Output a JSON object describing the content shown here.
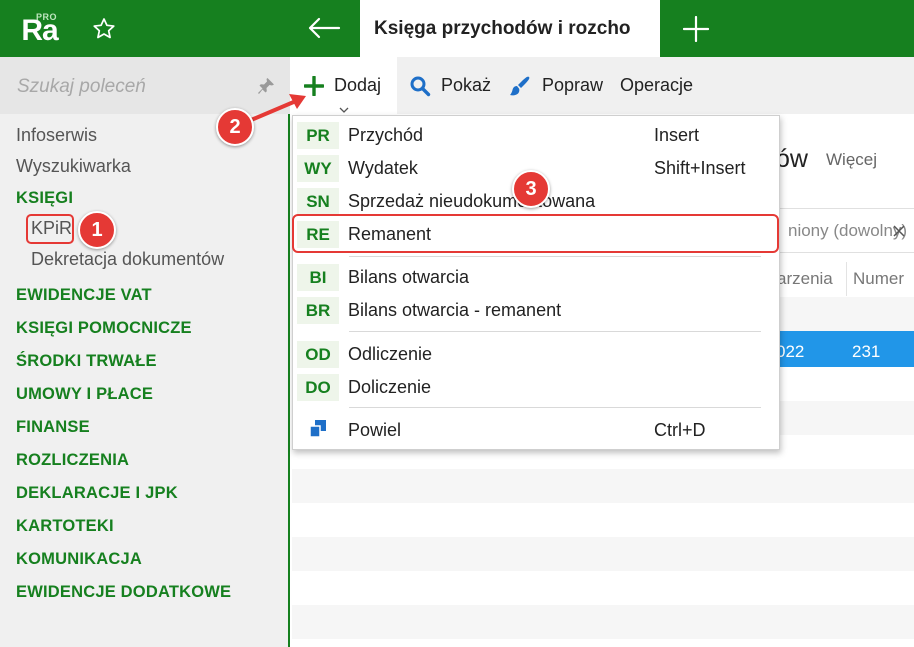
{
  "app": {
    "logo_text": "Ra",
    "logo_badge": "PRO",
    "tab_title": "Księga przychodów i rozcho",
    "accent_color": "#16801f",
    "selection_color": "#2196e8",
    "annotation_color": "#e53935"
  },
  "icons": {
    "star": "star-icon",
    "back": "arrow-left-icon",
    "new_tab": "plus-icon",
    "pin": "pin-icon",
    "add": "plus-icon",
    "show": "search-icon",
    "edit": "brush-icon",
    "copy": "copy-icon"
  },
  "sidebar": {
    "search_placeholder": "Szukaj poleceń",
    "items": [
      "Infoserwis",
      "Wyszukiwarka"
    ],
    "sections": [
      "KSIĘGI",
      "EWIDENCJE VAT",
      "KSIĘGI POMOCNICZE",
      "ŚRODKI TRWAŁE",
      "UMOWY I PŁACE",
      "FINANSE",
      "ROZLICZENIA",
      "DEKLARACJE I JPK",
      "KARTOTEKI",
      "KOMUNIKACJA",
      "EWIDENCJE DODATKOWE"
    ],
    "subitems": [
      "KPiR",
      "Dekretacja dokumentów"
    ]
  },
  "toolbar": {
    "add_label": "Dodaj",
    "show_label": "Pokaż",
    "edit_label": "Popraw",
    "operations_label": "Operacje"
  },
  "main": {
    "heading_suffix": "ów",
    "more_label": "Więcej",
    "filter_text": "niony (dowolny)",
    "columns": [
      "arzenia",
      "Numer"
    ],
    "selected_row": {
      "date_fragment": "022",
      "number": "231"
    }
  },
  "menu": {
    "items": [
      {
        "code": "PR",
        "label": "Przychód",
        "shortcut": "Insert"
      },
      {
        "code": "WY",
        "label": "Wydatek",
        "shortcut": "Shift+Insert"
      },
      {
        "code": "SN",
        "label": "Sprzedaż nieudokumentowana",
        "shortcut": ""
      },
      {
        "code": "RE",
        "label": "Remanent",
        "shortcut": ""
      },
      {
        "code": "BI",
        "label": "Bilans otwarcia",
        "shortcut": ""
      },
      {
        "code": "BR",
        "label": "Bilans otwarcia - remanent",
        "shortcut": ""
      },
      {
        "code": "OD",
        "label": "Odliczenie",
        "shortcut": ""
      },
      {
        "code": "DO",
        "label": "Doliczenie",
        "shortcut": ""
      }
    ],
    "copy_item": {
      "label": "Powiel",
      "shortcut": "Ctrl+D"
    }
  },
  "callouts": [
    "1",
    "2",
    "3"
  ]
}
